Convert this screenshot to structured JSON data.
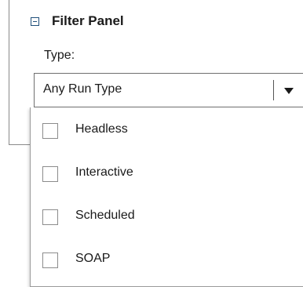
{
  "filter_panel": {
    "title": "Filter Panel",
    "collapse_icon": "collapse-minus-icon",
    "type_label": "Type:",
    "run_type_select": {
      "selected_value": "Any Run Type",
      "arrow_icon": "dropdown-arrow-icon"
    },
    "run_type_options": [
      {
        "label": "Headless",
        "checked": false
      },
      {
        "label": "Interactive",
        "checked": false
      },
      {
        "label": "Scheduled",
        "checked": false
      },
      {
        "label": "SOAP",
        "checked": false
      }
    ]
  }
}
